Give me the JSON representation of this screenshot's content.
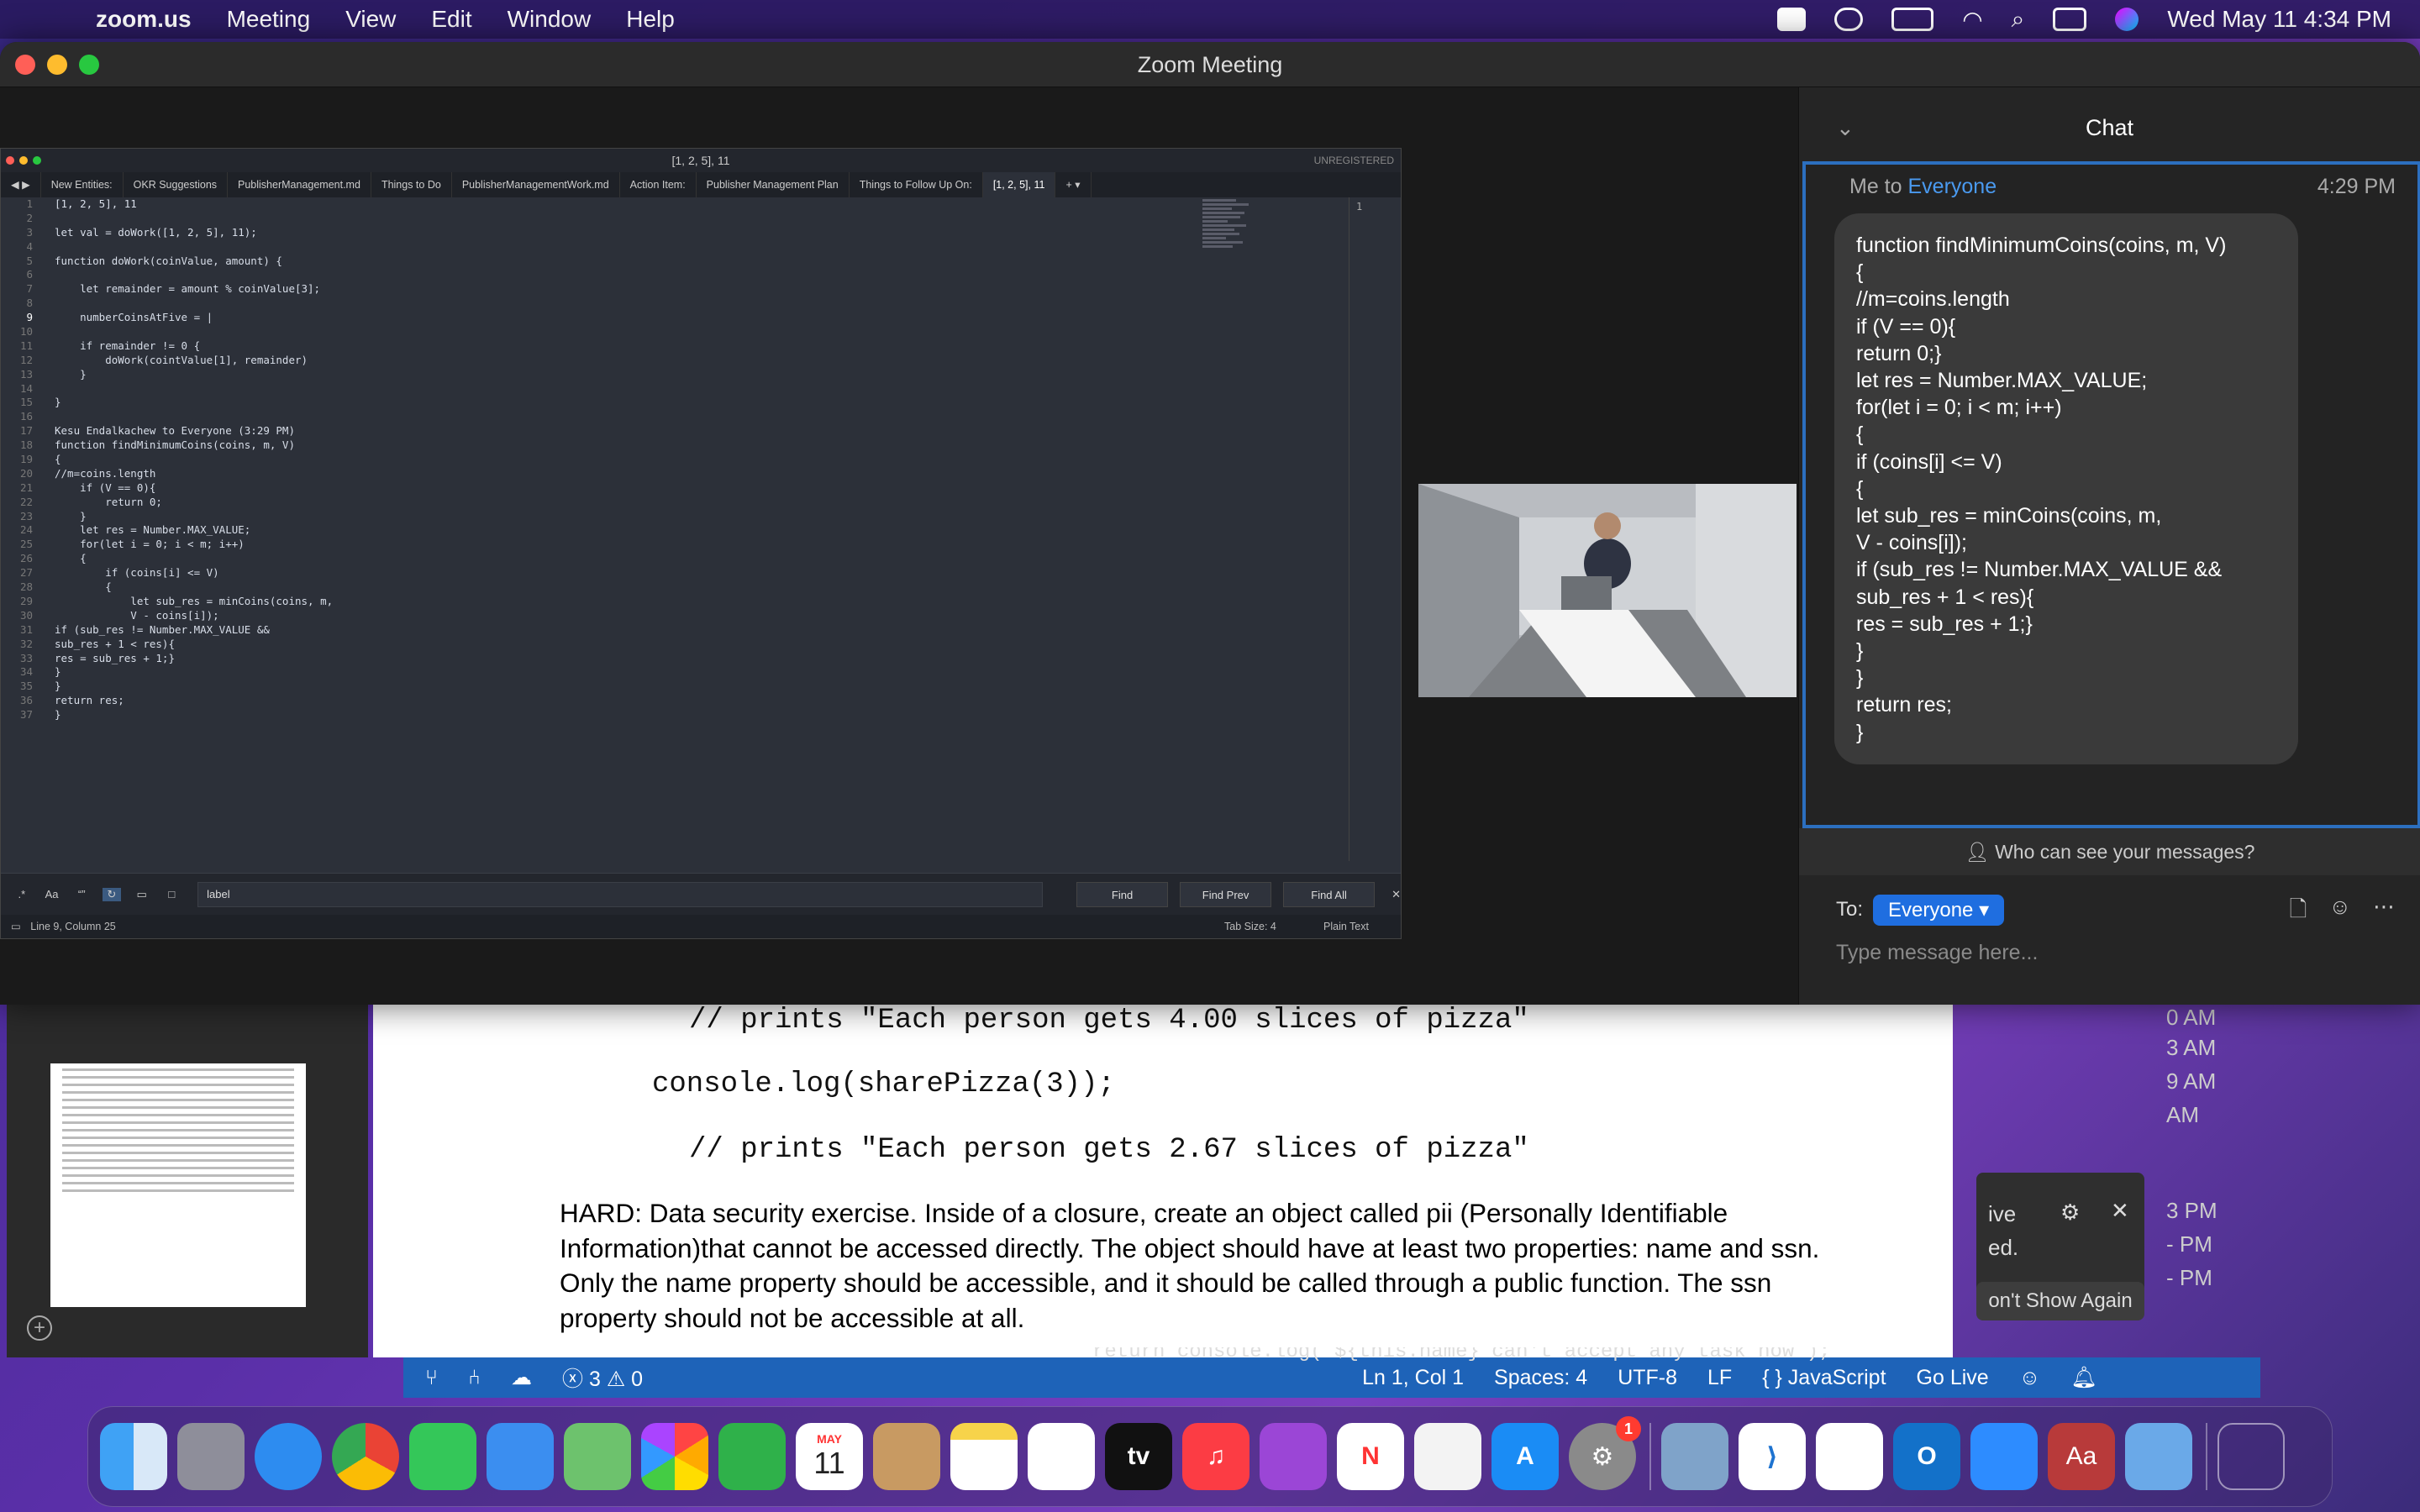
{
  "menubar": {
    "app": "zoom.us",
    "items": [
      "Meeting",
      "View",
      "Edit",
      "Window",
      "Help"
    ],
    "datetime": "Wed May 11  4:34 PM"
  },
  "zoom": {
    "title": "Zoom Meeting"
  },
  "sublime": {
    "title": "[1, 2, 5], 11",
    "unregistered": "UNREGISTERED",
    "tabs": [
      "New Entities:",
      "OKR Suggestions",
      "PublisherManagement.md",
      "Things to Do",
      "PublisherManagementWork.md",
      "Action Item:",
      "Publisher Management Plan",
      "Things to Follow Up On:",
      "[1, 2, 5], 11"
    ],
    "code_lines": [
      "[1, 2, 5], 11",
      "",
      "let val = doWork([1, 2, 5], 11);",
      "",
      "function doWork(coinValue, amount) {",
      "",
      "    let remainder = amount % coinValue[3];",
      "",
      "    numberCoinsAtFive = |",
      "",
      "    if remainder != 0 {",
      "        doWork(cointValue[1], remainder)",
      "    }",
      "",
      "}",
      "",
      "Kesu Endalkachew to Everyone (3:29 PM)",
      "function findMinimumCoins(coins, m, V)",
      "{",
      "//m=coins.length",
      "    if (V == 0){",
      "        return 0;",
      "    }",
      "    let res = Number.MAX_VALUE;",
      "    for(let i = 0; i < m; i++)",
      "    {",
      "        if (coins[i] <= V)",
      "        {",
      "            let sub_res = minCoins(coins, m,",
      "            V - coins[i]);",
      "if (sub_res != Number.MAX_VALUE &&",
      "sub_res + 1 < res){",
      "res = sub_res + 1;}",
      "}",
      "}",
      "return res;",
      "}"
    ],
    "right_pane_line": "1",
    "find": {
      "value": "label",
      "find": "Find",
      "find_prev": "Find Prev",
      "find_all": "Find All"
    },
    "status": {
      "position": "Line 9, Column 25",
      "tab_size": "Tab Size: 4",
      "syntax": "Plain Text"
    }
  },
  "chat": {
    "title": "Chat",
    "sender": "Me to ",
    "recipient": "Everyone",
    "time": "4:29 PM",
    "message_lines": [
      "function findMinimumCoins(coins, m, V)",
      "{",
      "//m=coins.length",
      "if (V == 0){",
      "return 0;}",
      "let res = Number.MAX_VALUE;",
      "for(let i = 0; i < m; i++)",
      "{",
      "if (coins[i] <= V)",
      "{",
      "let sub_res = minCoins(coins, m,",
      "V - coins[i]);",
      "if (sub_res != Number.MAX_VALUE &&",
      "sub_res + 1 < res){",
      "res = sub_res + 1;}",
      "}",
      "}",
      "return res;",
      "}"
    ],
    "privacy": "Who can see your messages?",
    "to_label": "To:",
    "to_value": "Everyone",
    "placeholder": "Type message here..."
  },
  "document": {
    "line1": "// prints \"Each person gets 4.00 slices of pizza\"",
    "line2": "console.log(sharePizza(3));",
    "line3": "// prints \"Each person gets 2.67 slices of pizza\"",
    "hard": "HARD: Data security exercise. Inside of a closure, create an object called pii (Personally Identifiable Information)that cannot be accessed directly. The object should have at least two properties: name and ssn. Only the name property should be accessible, and it should be called through a public function. The ssn property should not be accessible at all."
  },
  "notification": {
    "line1": "ive",
    "line2": "ed.",
    "button": "on't Show Again"
  },
  "calendar_strip": [
    "0 AM",
    "3 AM",
    "9 AM",
    "AM",
    "3 PM",
    "- PM",
    "- PM"
  ],
  "vscode_status": {
    "problems": "ⓧ 3 ⚠ 0",
    "position": "Ln 1, Col 1",
    "spaces": "Spaces: 4",
    "encoding": "UTF-8",
    "eol": "LF",
    "language": "{ } JavaScript",
    "golive": "Go Live",
    "background_code": "return console.log(`${this.name} can't accept any task now`);"
  },
  "dock": {
    "calendar_month": "MAY",
    "calendar_day": "11",
    "appletv": "tv",
    "settings_badge": "1",
    "dictionary": "Aa"
  }
}
